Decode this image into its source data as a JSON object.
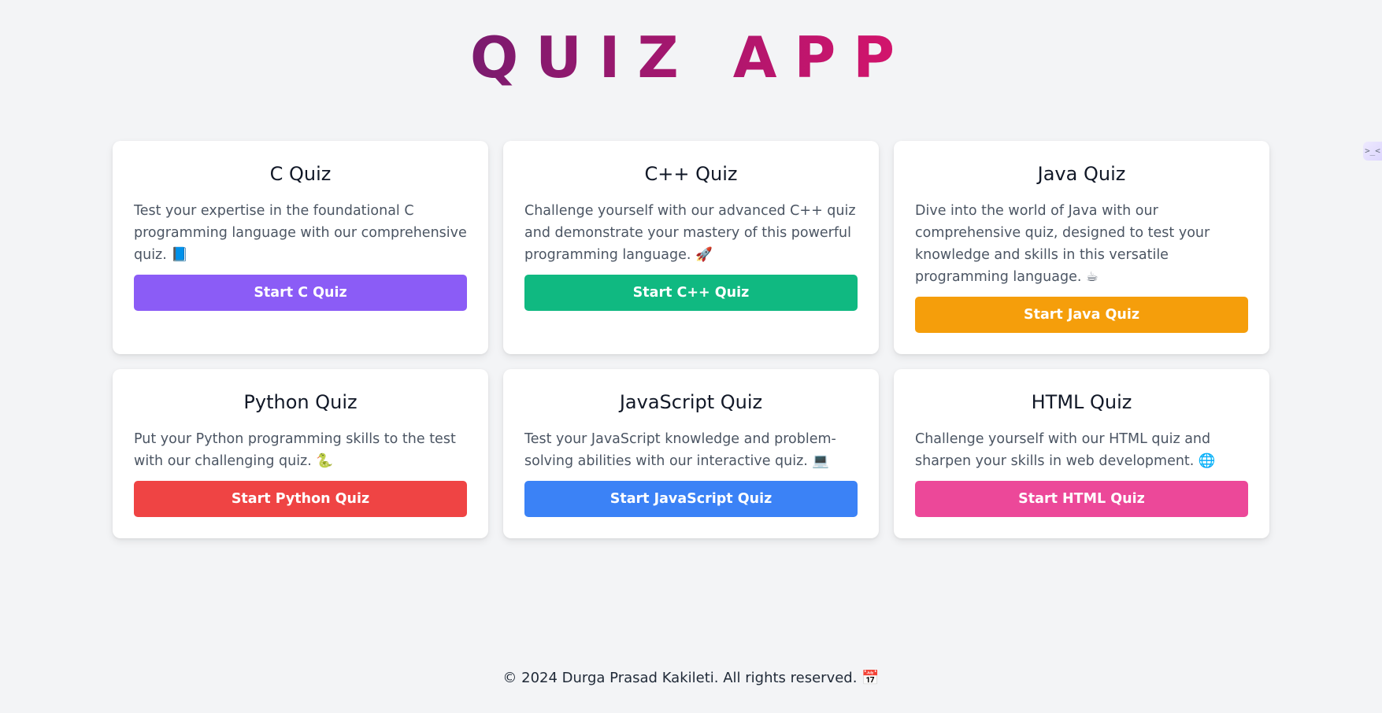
{
  "header": {
    "title": "QUIZ APP"
  },
  "quizzes": [
    {
      "title": "C Quiz",
      "description": "Test your expertise in the foundational C programming language with our comprehensive quiz. 📘",
      "button_label": "Start C Quiz",
      "color": "#8b5cf6"
    },
    {
      "title": "C++ Quiz",
      "description": "Challenge yourself with our advanced C++ quiz and demonstrate your mastery of this powerful programming language. 🚀",
      "button_label": "Start C++ Quiz",
      "color": "#10b981"
    },
    {
      "title": "Java Quiz",
      "description": "Dive into the world of Java with our comprehensive quiz, designed to test your knowledge and skills in this versatile programming language. ☕",
      "button_label": "Start Java Quiz",
      "color": "#f59e0b"
    },
    {
      "title": "Python Quiz",
      "description": "Put your Python programming skills to the test with our challenging quiz. 🐍",
      "button_label": "Start Python Quiz",
      "color": "#ef4444"
    },
    {
      "title": "JavaScript Quiz",
      "description": "Test your JavaScript knowledge and problem-solving abilities with our interactive quiz. 💻",
      "button_label": "Start JavaScript Quiz",
      "color": "#3b82f6"
    },
    {
      "title": "HTML Quiz",
      "description": "Challenge yourself with our HTML quiz and sharpen your skills in web development. 🌐",
      "button_label": "Start HTML Quiz",
      "color": "#ec4899"
    }
  ],
  "footer": {
    "text": "© 2024 Durga Prasad Kakileti. All rights reserved. 📅"
  },
  "side_tab": {
    "icon": "code-icon",
    "glyph": ">_<"
  }
}
